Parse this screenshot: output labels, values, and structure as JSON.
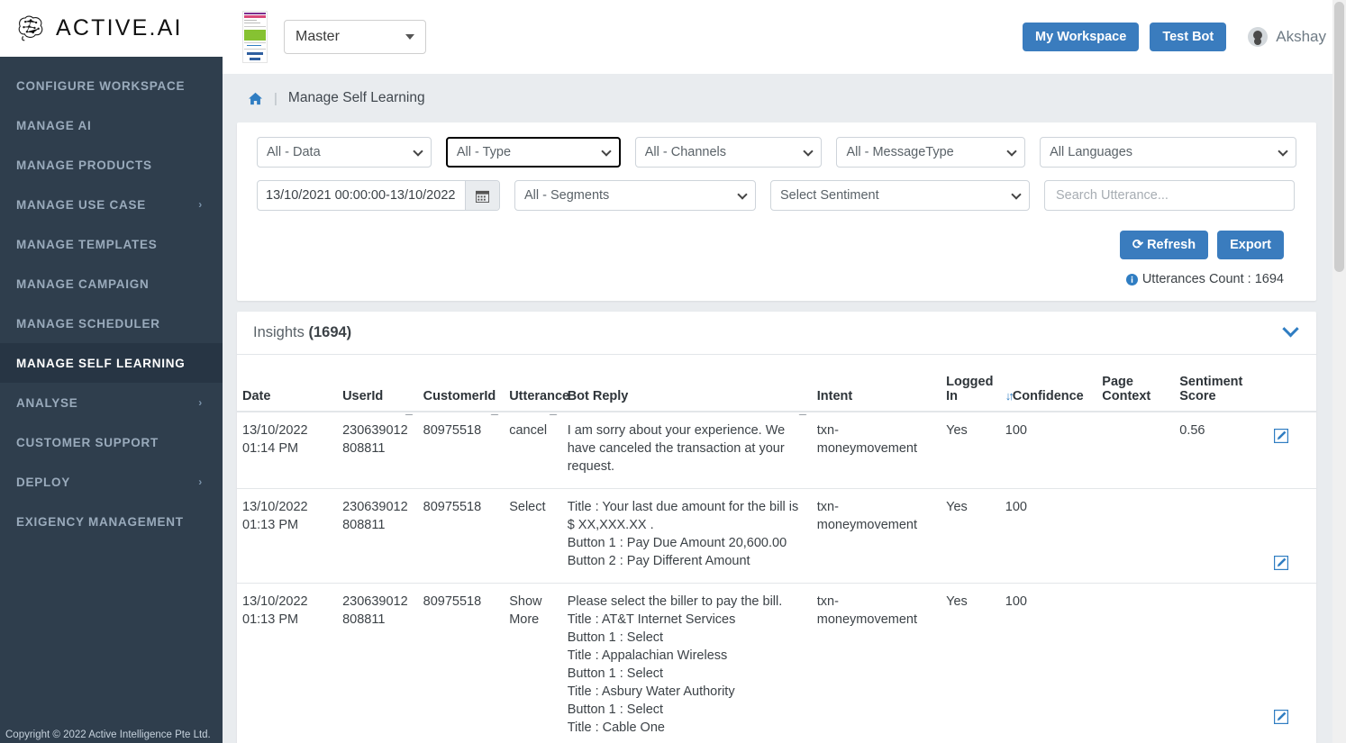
{
  "brand": {
    "name": "ACTIVE.AI",
    "logo_icon": "brain-logo-icon"
  },
  "sidebar": {
    "items": [
      {
        "label": "CONFIGURE WORKSPACE",
        "active": false,
        "caret": false
      },
      {
        "label": "MANAGE AI",
        "active": false,
        "caret": false
      },
      {
        "label": "MANAGE PRODUCTS",
        "active": false,
        "caret": false
      },
      {
        "label": "MANAGE USE CASE",
        "active": false,
        "caret": true
      },
      {
        "label": "MANAGE TEMPLATES",
        "active": false,
        "caret": false
      },
      {
        "label": "MANAGE CAMPAIGN",
        "active": false,
        "caret": false
      },
      {
        "label": "MANAGE SCHEDULER",
        "active": false,
        "caret": false
      },
      {
        "label": "MANAGE SELF LEARNING",
        "active": true,
        "caret": false
      },
      {
        "label": "ANALYSE",
        "active": false,
        "caret": true
      },
      {
        "label": "CUSTOMER SUPPORT",
        "active": false,
        "caret": false
      },
      {
        "label": "DEPLOY",
        "active": false,
        "caret": true
      },
      {
        "label": "EXIGENCY MANAGEMENT",
        "active": false,
        "caret": false
      }
    ],
    "footer": "Copyright © 2022 Active Intelligence Pte Ltd."
  },
  "topbar": {
    "workspace_value": "Master",
    "my_workspace_label": "My Workspace",
    "test_bot_label": "Test Bot",
    "user_name": "Akshay"
  },
  "breadcrumb": {
    "home_icon": "home-icon",
    "separator": "|",
    "title": "Manage Self Learning"
  },
  "filters": {
    "data": "All - Data",
    "type": "All - Type",
    "channels": "All - Channels",
    "message_type": "All - MessageType",
    "languages": "All Languages",
    "date_range": "13/10/2021 00:00:00-13/10/2022",
    "segments": "All - Segments",
    "sentiment": "Select Sentiment",
    "search_placeholder": "Search Utterance...",
    "search_value": ""
  },
  "buttons": {
    "refresh": "Refresh",
    "export": "Export"
  },
  "utterances": {
    "label": "Utterances Count : 1694"
  },
  "panel": {
    "title": "Insights",
    "count": "(1694)"
  },
  "table": {
    "columns": [
      "Date",
      "UserId",
      "CustomerId",
      "Utterance",
      "Bot Reply",
      "Intent",
      "Logged In",
      "Confidence",
      "Page Context",
      "Sentiment Score"
    ],
    "sorted_column": "Confidence",
    "rows": [
      {
        "date": "13/10/2022 01:14 PM",
        "user_id": "230639012808811",
        "customer_id": "80975518",
        "utterance": "cancel",
        "bot_reply": "I am sorry about your experience. We have canceled the transaction at your request.",
        "intent": "txn-moneymovement",
        "logged_in": "Yes",
        "confidence": "100",
        "page_context": "",
        "sentiment_score": "0.56"
      },
      {
        "date": "13/10/2022 01:13 PM",
        "user_id": "230639012808811",
        "customer_id": "80975518",
        "utterance": "Select",
        "bot_reply": "Title : Your last due amount for the bill is $ XX,XXX.XX .\nButton 1 : Pay Due Amount 20,600.00\nButton 2 : Pay Different Amount",
        "intent": "txn-moneymovement",
        "logged_in": "Yes",
        "confidence": "100",
        "page_context": "",
        "sentiment_score": ""
      },
      {
        "date": "13/10/2022 01:13 PM",
        "user_id": "230639012808811",
        "customer_id": "80975518",
        "utterance": "Show More",
        "bot_reply": "Please select the biller to pay the bill.\nTitle : AT&T Internet Services\nButton 1 : Select\nTitle : Appalachian Wireless\nButton 1 : Select\nTitle : Asbury Water Authority\nButton 1 : Select\nTitle : Cable One",
        "intent": "txn-moneymovement",
        "logged_in": "Yes",
        "confidence": "100",
        "page_context": "",
        "sentiment_score": ""
      }
    ]
  },
  "colors": {
    "accent": "#3a7cbe",
    "sidebar": "#2f3e4d",
    "sidebar_active": "#273544",
    "canvas": "#e9ecef"
  }
}
